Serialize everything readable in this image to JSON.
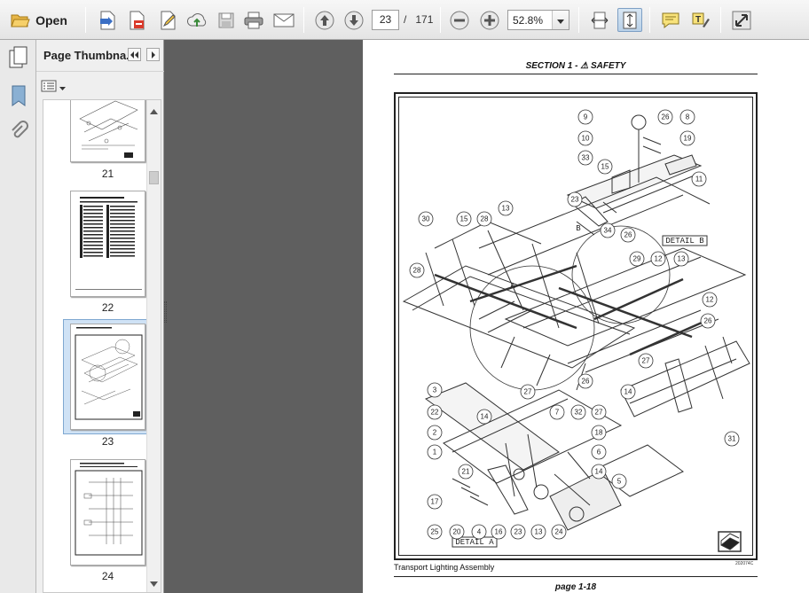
{
  "toolbar": {
    "open_label": "Open",
    "current_page": "23",
    "page_separator": "/",
    "total_pages": "171",
    "zoom": "52.8%",
    "icons": [
      "open-folder-icon",
      "create-pdf-icon",
      "export-icon",
      "edit-icon",
      "upload-cloud-icon",
      "save-icon",
      "print-icon",
      "email-icon",
      "previous-page-icon",
      "next-page-icon",
      "zoom-out-icon",
      "zoom-in-icon",
      "fit-width-icon",
      "fit-page-icon",
      "comment-icon",
      "highlight-text-icon",
      "fullscreen-icon"
    ]
  },
  "rail": {
    "icons": [
      "page-thumbnails-icon",
      "bookmarks-icon",
      "attachments-icon"
    ]
  },
  "thumbnails": {
    "title": "Page Thumbna...",
    "pages": [
      {
        "number": "21",
        "selected": false,
        "kind": "drawing"
      },
      {
        "number": "22",
        "selected": false,
        "kind": "table"
      },
      {
        "number": "23",
        "selected": true,
        "kind": "drawing"
      },
      {
        "number": "24",
        "selected": false,
        "kind": "schematic"
      }
    ]
  },
  "document": {
    "section_header": "SECTION 1 - ⚠ SAFETY",
    "caption": "Transport Lighting Assembly",
    "figure_code": "202074C",
    "page_label": "page 1-18",
    "detail_a": "DETAIL A",
    "detail_b": "DETAIL B",
    "callouts": [
      "9",
      "26",
      "8",
      "10",
      "19",
      "33",
      "15",
      "11",
      "23",
      "13",
      "30",
      "15",
      "28",
      "34",
      "26",
      "29",
      "12",
      "13",
      "12",
      "28",
      "26",
      "27",
      "26",
      "14",
      "31",
      "3",
      "27",
      "22",
      "14",
      "7",
      "32",
      "27",
      "2",
      "18",
      "1",
      "6",
      "21",
      "14",
      "5",
      "17",
      "25",
      "20",
      "4",
      "16",
      "23",
      "13",
      "24"
    ]
  }
}
